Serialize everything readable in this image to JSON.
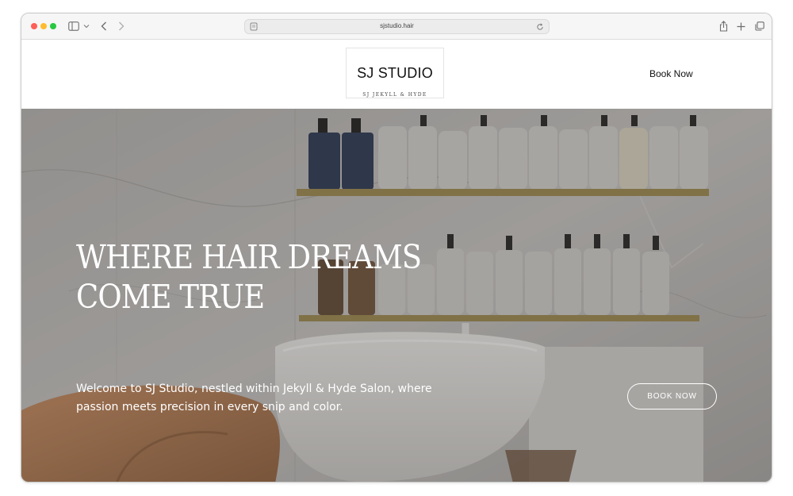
{
  "browser": {
    "url": "sjstudio.hair"
  },
  "site": {
    "logo_title": "SJ STUDIO",
    "logo_subtitle": "SJ JEKYLL & HYDE",
    "nav_book": "Book Now"
  },
  "hero": {
    "title_line1": "WHERE HAIR DREAMS",
    "title_line2": "COME TRUE",
    "description": "Welcome to SJ Studio, nestled within Jekyll & Hyde Salon, where passion meets precision in every snip and color.",
    "button_label": "BOOK NOW"
  },
  "colors": {
    "traffic_red": "#fe5f57",
    "traffic_yellow": "#febc2e",
    "traffic_green": "#28c840",
    "hero_overlay": "#7d7a78"
  }
}
